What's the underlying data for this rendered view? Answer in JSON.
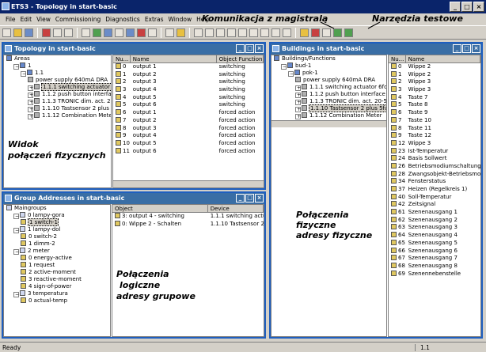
{
  "app": {
    "title": "ETS3 - Topology in start-basic"
  },
  "menu": [
    "File",
    "Edit",
    "View",
    "Commissioning",
    "Diagnostics",
    "Extras",
    "Window",
    "Help"
  ],
  "annotations": {
    "bus_comm": "Komunikacja z magistralą",
    "test_tools": "Narzędzia testowe",
    "physical_view_1": "Widok",
    "physical_view_2": "połączeń fizycznych",
    "logical_1": "Połączenia",
    "logical_2": "logiczne",
    "logical_3": "adresy grupowe",
    "physical_addr_1": "Połączenia",
    "physical_addr_2": "fizyczne",
    "physical_addr_3": "adresy fizyczne"
  },
  "topology": {
    "title": "Topology in start-basic",
    "tree": [
      {
        "label": "Areas",
        "indent": 0,
        "icon": "net",
        "exp": ""
      },
      {
        "label": "1",
        "indent": 1,
        "icon": "net",
        "exp": "-"
      },
      {
        "label": "1.1",
        "indent": 2,
        "icon": "net",
        "exp": "-"
      },
      {
        "label": "power supply 640mA DRA",
        "indent": 3,
        "icon": "dev",
        "exp": ""
      },
      {
        "label": "1.1.1 switching actuator 6fold",
        "indent": 3,
        "icon": "dev",
        "exp": "+",
        "selected": true
      },
      {
        "label": "1.1.2 push button interface :",
        "indent": 3,
        "icon": "dev",
        "exp": "+"
      },
      {
        "label": "1.1.3 TRONIC dim. act. 20-50",
        "indent": 3,
        "icon": "dev",
        "exp": "+"
      },
      {
        "label": "1.1.10 Tastsensor 2 plus 5fa",
        "indent": 3,
        "icon": "dev",
        "exp": "+"
      },
      {
        "label": "1.1.12 Combination Meter",
        "indent": 3,
        "icon": "dev",
        "exp": "+"
      }
    ],
    "list_headers": [
      "Nu...",
      "Name",
      "Object Function"
    ],
    "rows": [
      {
        "num": "0",
        "name": "output 1",
        "func": "switching"
      },
      {
        "num": "1",
        "name": "output 2",
        "func": "switching"
      },
      {
        "num": "2",
        "name": "output 3",
        "func": "switching"
      },
      {
        "num": "3",
        "name": "output 4",
        "func": "switching"
      },
      {
        "num": "4",
        "name": "output 5",
        "func": "switching"
      },
      {
        "num": "5",
        "name": "output 6",
        "func": "switching"
      },
      {
        "num": "6",
        "name": "output 1",
        "func": "forced action"
      },
      {
        "num": "7",
        "name": "output 2",
        "func": "forced action"
      },
      {
        "num": "8",
        "name": "output 3",
        "func": "forced action"
      },
      {
        "num": "9",
        "name": "output 4",
        "func": "forced action"
      },
      {
        "num": "10",
        "name": "output 5",
        "func": "forced action"
      },
      {
        "num": "11",
        "name": "output 6",
        "func": "forced action"
      }
    ]
  },
  "groups": {
    "title": "Group Addresses in start-basic",
    "tree": [
      {
        "label": "Maingroups",
        "indent": 0,
        "icon": "grp",
        "exp": ""
      },
      {
        "label": "0 lampy-gora",
        "indent": 1,
        "icon": "grp",
        "exp": "-"
      },
      {
        "label": "1 switch-1",
        "indent": 2,
        "icon": "obj",
        "exp": "",
        "selected": true
      },
      {
        "label": "1 lampy-dol",
        "indent": 1,
        "icon": "grp",
        "exp": "-"
      },
      {
        "label": "0 switch-2",
        "indent": 2,
        "icon": "obj",
        "exp": ""
      },
      {
        "label": "1 dimm-2",
        "indent": 2,
        "icon": "obj",
        "exp": ""
      },
      {
        "label": "2 meter",
        "indent": 1,
        "icon": "grp",
        "exp": "-"
      },
      {
        "label": "0 energy-active",
        "indent": 2,
        "icon": "obj",
        "exp": ""
      },
      {
        "label": "1 request",
        "indent": 2,
        "icon": "obj",
        "exp": ""
      },
      {
        "label": "2 active-moment",
        "indent": 2,
        "icon": "obj",
        "exp": ""
      },
      {
        "label": "3 reactive-moment",
        "indent": 2,
        "icon": "obj",
        "exp": ""
      },
      {
        "label": "4 sign-of-power",
        "indent": 2,
        "icon": "obj",
        "exp": ""
      },
      {
        "label": "3 temperatura",
        "indent": 1,
        "icon": "grp",
        "exp": "-"
      },
      {
        "label": "0 actual-temp",
        "indent": 2,
        "icon": "obj",
        "exp": ""
      }
    ],
    "list_headers": [
      "Object",
      "Device"
    ],
    "rows": [
      {
        "object": "3: output 4 - switching",
        "device": "1.1.1 switching actuator"
      },
      {
        "object": "0: Wippe 2 - Schalten",
        "device": "1.1.10 Tastsensor 2 plus"
      }
    ]
  },
  "buildings": {
    "title": "Buildings in start-basic",
    "tree": [
      {
        "label": "Buildings/Functions",
        "indent": 0,
        "icon": "net",
        "exp": ""
      },
      {
        "label": "bud-1",
        "indent": 1,
        "icon": "net",
        "exp": "-"
      },
      {
        "label": "pok-1",
        "indent": 2,
        "icon": "net",
        "exp": "-"
      },
      {
        "label": "power supply 640mA DRA",
        "indent": 3,
        "icon": "dev",
        "exp": ""
      },
      {
        "label": "1.1.1 switching actuator 6fold 6A",
        "indent": 3,
        "icon": "dev",
        "exp": "+"
      },
      {
        "label": "1.1.2 push button interface 2.0 F",
        "indent": 3,
        "icon": "dev",
        "exp": "+"
      },
      {
        "label": "1.1.3 TRONIC dim. act. 20-500W",
        "indent": 3,
        "icon": "dev",
        "exp": "+"
      },
      {
        "label": "1.1.10 Tastsensor 2 plus 5fach V2",
        "indent": 3,
        "icon": "dev",
        "exp": "+",
        "selected": true
      },
      {
        "label": "1.1.12 Combination Meter",
        "indent": 3,
        "icon": "dev",
        "exp": "+"
      }
    ],
    "list_headers": [
      "Nu...",
      "Name"
    ],
    "rows": [
      {
        "num": "0",
        "name": "Wippe 2"
      },
      {
        "num": "1",
        "name": "Wippe 2"
      },
      {
        "num": "2",
        "name": "Wippe 3"
      },
      {
        "num": "3",
        "name": "Wippe 3"
      },
      {
        "num": "4",
        "name": "Taste 7"
      },
      {
        "num": "5",
        "name": "Taste 8"
      },
      {
        "num": "6",
        "name": "Taste 9"
      },
      {
        "num": "7",
        "name": "Taste 10"
      },
      {
        "num": "8",
        "name": "Taste 11"
      },
      {
        "num": "9",
        "name": "Taste 12"
      },
      {
        "num": "12",
        "name": "Wippe 3"
      },
      {
        "num": "23",
        "name": "Ist-Temperatur"
      },
      {
        "num": "24",
        "name": "Basis Sollwert"
      },
      {
        "num": "26",
        "name": "Betriebsmodiumschaltung"
      },
      {
        "num": "28",
        "name": "Zwangsobjekt-Betriebsmodus"
      },
      {
        "num": "34",
        "name": "Fensterstatus"
      },
      {
        "num": "37",
        "name": "Heizen (Regelkreis 1)"
      },
      {
        "num": "40",
        "name": "Soll-Temperatur"
      },
      {
        "num": "42",
        "name": "Zeitsignal"
      },
      {
        "num": "61",
        "name": "Szenenausgang 1"
      },
      {
        "num": "62",
        "name": "Szenenausgang 2"
      },
      {
        "num": "63",
        "name": "Szenenausgang 3"
      },
      {
        "num": "64",
        "name": "Szenenausgang 4"
      },
      {
        "num": "65",
        "name": "Szenenausgang 5"
      },
      {
        "num": "66",
        "name": "Szenenausgang 6"
      },
      {
        "num": "67",
        "name": "Szenenausgang 7"
      },
      {
        "num": "68",
        "name": "Szenenausgang 8"
      },
      {
        "num": "69",
        "name": "Szenennebenstelle"
      }
    ]
  },
  "status": {
    "left": "Ready",
    "right": "1.1"
  }
}
